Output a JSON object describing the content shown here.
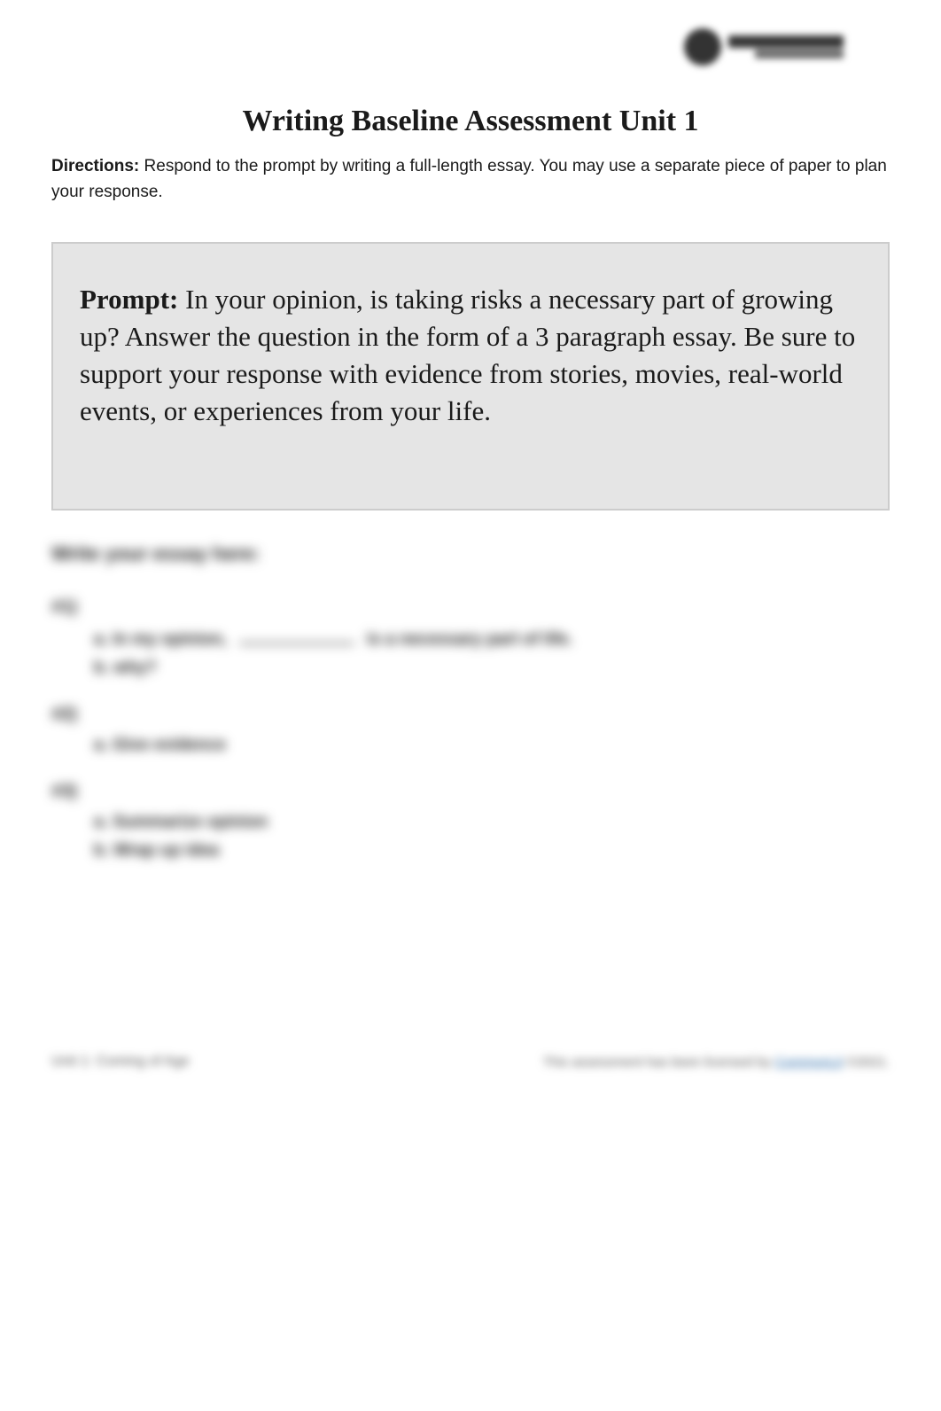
{
  "title": "Writing Baseline Assessment Unit 1",
  "directions": {
    "label": "Directions:",
    "text": " Respond to the prompt by writing a full-length essay. You may use a separate piece of paper to plan your response."
  },
  "prompt": {
    "label": "Prompt:",
    "text": " In your opinion, is taking risks a necessary part of growing up? Answer the question in the form of a 3 paragraph essay. Be sure to support your response with evidence from stories, movies, real-world events, or experiences from your life."
  },
  "essay": {
    "heading": "Write your essay here:",
    "p1": {
      "label": "#1)",
      "item_a_prefix": "a. In my opinion, ",
      "item_a_suffix": " is a necessary part of life.",
      "item_b": "b. why?"
    },
    "p2": {
      "label": "#2)",
      "item_a": "a. Give evidence"
    },
    "p3": {
      "label": "#3)",
      "item_a": "a. Summarize opinion",
      "item_b": "b. Wrap up idea"
    }
  },
  "footer": {
    "left": "Unit 1: Coming of Age",
    "right_prefix": "This assessment has been licensed by ",
    "right_link": "CommonLit",
    "right_suffix": " ©2021."
  }
}
